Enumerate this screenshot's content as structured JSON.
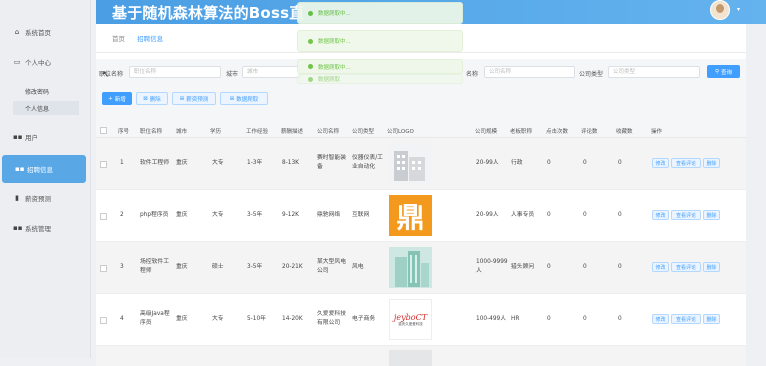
{
  "header": {
    "title": "基于随机森林算法的Boss直"
  },
  "sidebar": {
    "items": [
      {
        "label": "系统首页",
        "icon": "home-icon"
      },
      {
        "label": "个人中心",
        "icon": "user-card-icon"
      },
      {
        "label": "用户",
        "icon": "grid-icon"
      },
      {
        "label": "招聘信息",
        "icon": "grid-icon"
      },
      {
        "label": "薪资预测",
        "icon": "chart-icon"
      },
      {
        "label": "系统管理",
        "icon": "grid-icon"
      }
    ],
    "sub_items": [
      "修改密码",
      "个人信息"
    ]
  },
  "breadcrumb": {
    "home": "首页",
    "current": "招聘信息"
  },
  "search": {
    "labels": [
      "职位名称",
      "城市",
      "名称",
      "公司类型"
    ],
    "placeholders": [
      "职位名称",
      "城市",
      "公司名称",
      "公司类型"
    ],
    "query_button": "查询"
  },
  "toolbar": {
    "add": "新增",
    "delete": "删除",
    "export": "薪资预测",
    "refresh": "数据爬取"
  },
  "table": {
    "headers": [
      "序号",
      "职位名称",
      "城市",
      "学历",
      "工作经验",
      "薪酬描述",
      "公司名称",
      "公司类型",
      "公司LOGO",
      "公司规模",
      "老板职称",
      "点击次数",
      "评论数",
      "收藏数",
      "操作"
    ],
    "rows": [
      {
        "no": "1",
        "job": "软件工程师",
        "city": "重庆",
        "edu": "大专",
        "exp": "1-3年",
        "salary": "8-13K",
        "company": "赛时智能装备",
        "type": "仪器仪表/工业自动化",
        "size": "20-99人",
        "boss": "行政",
        "clicks": "0",
        "comments": "0",
        "favs": "0",
        "logo": "building"
      },
      {
        "no": "2",
        "job": "php程序员",
        "city": "重庆",
        "edu": "大专",
        "exp": "3-5年",
        "salary": "9-12K",
        "company": "鼎驰网络",
        "type": "互联网",
        "size": "20-99人",
        "boss": "人事专员",
        "clicks": "0",
        "comments": "0",
        "favs": "0",
        "logo": "ding"
      },
      {
        "no": "3",
        "job": "场控软件工程师",
        "city": "重庆",
        "edu": "硕士",
        "exp": "3-5年",
        "salary": "20-21K",
        "company": "某大型风电公司",
        "type": "风电",
        "size": "1000-9999人",
        "boss": "猎头顾问",
        "clicks": "0",
        "comments": "0",
        "favs": "0",
        "logo": "teal"
      },
      {
        "no": "4",
        "job": "高级Java程序员",
        "city": "重庆",
        "edu": "大专",
        "exp": "5-10年",
        "salary": "14-20K",
        "company": "久爱爱科技有限公司",
        "type": "电子商务",
        "size": "100-499人",
        "boss": "HR",
        "clicks": "0",
        "comments": "0",
        "favs": "0",
        "logo": "jcs"
      }
    ],
    "actions": [
      "修改",
      "查看评论",
      "删除"
    ]
  },
  "toasts": [
    "数据爬取中...",
    "数据爬取中...",
    "数据爬取中...",
    "数据爬取"
  ],
  "logo_text": {
    "ding": "鼎",
    "jcs": "jeyboCT",
    "jcs_sub": "重庆久爱爱科技"
  }
}
